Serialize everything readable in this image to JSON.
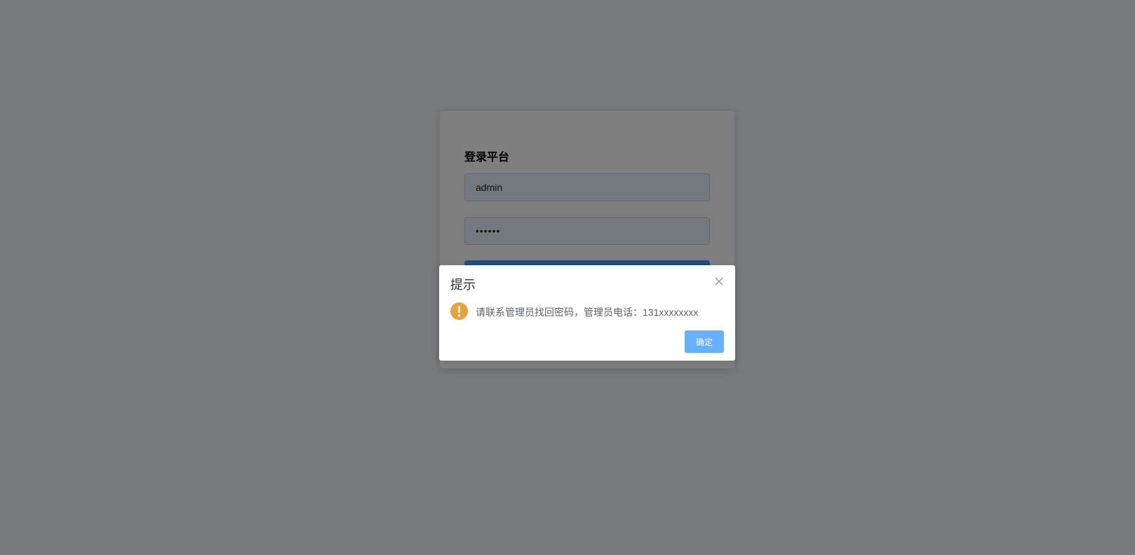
{
  "login": {
    "title": "登录平台",
    "username_value": "admin",
    "password_value": "••••••",
    "submit_label": ""
  },
  "dialog": {
    "title": "提示",
    "message": "请联系管理员找回密码，管理员电话：131xxxxxxxx",
    "confirm_label": "确定",
    "warning_icon": "warning-icon",
    "close_icon": "close-icon"
  },
  "colors": {
    "primary": "#409eff",
    "primary_light": "#66b1ff",
    "warning": "#e6a23c",
    "mask": "rgba(0,0,0,0.5)"
  }
}
